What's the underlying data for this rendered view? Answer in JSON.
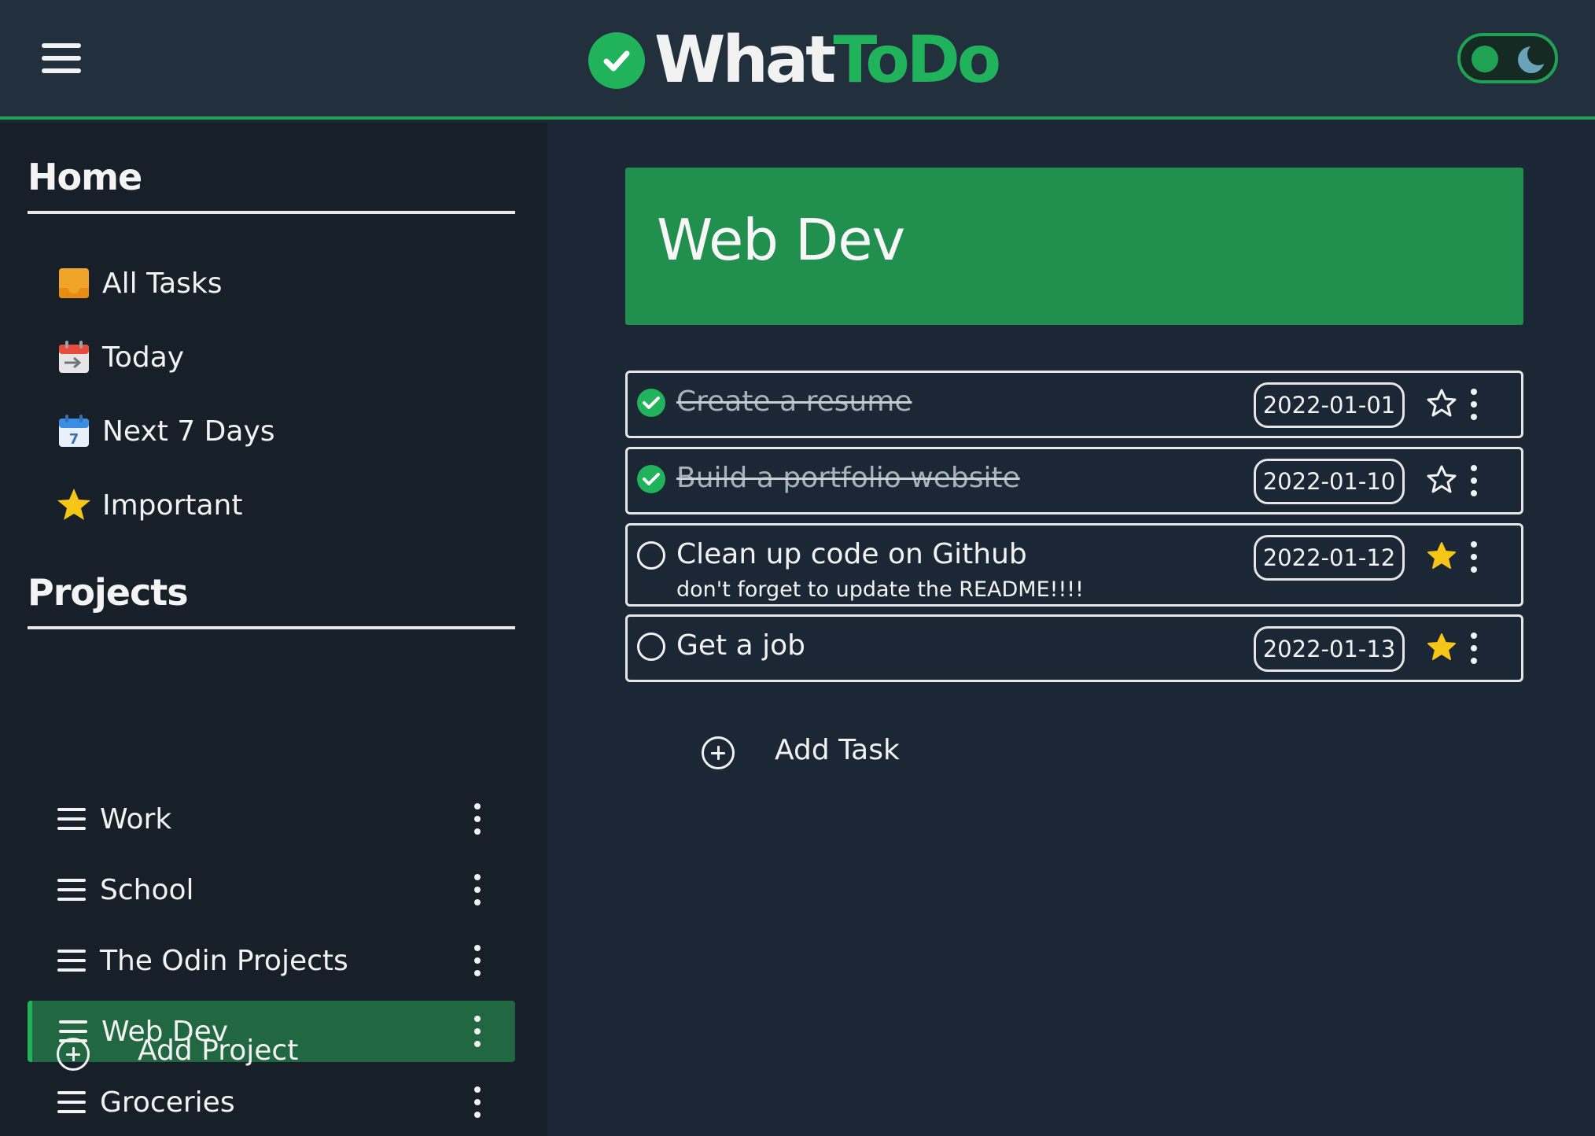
{
  "header": {
    "logo_what": "What",
    "logo_todo": "ToDo",
    "accent": "#21b35c"
  },
  "sidebar": {
    "home_title": "Home",
    "home_items": [
      {
        "label": "All Tasks",
        "icon": "inbox-tray-icon"
      },
      {
        "label": "Today",
        "icon": "calendar-today-icon"
      },
      {
        "label": "Next 7 Days",
        "icon": "calendar-week-icon"
      },
      {
        "label": "Important",
        "icon": "star-icon"
      }
    ],
    "projects_title": "Projects",
    "projects": [
      {
        "label": "Work",
        "active": false
      },
      {
        "label": "School",
        "active": false
      },
      {
        "label": "The Odin Projects",
        "active": false
      },
      {
        "label": "Web Dev",
        "active": true
      },
      {
        "label": "Groceries",
        "active": false
      }
    ],
    "add_project_label": "Add Project"
  },
  "main": {
    "project_title": "Web Dev",
    "tasks": [
      {
        "title": "Create a resume",
        "note": "",
        "date": "2022-01-01",
        "done": true,
        "important": false
      },
      {
        "title": "Build a portfolio website",
        "note": "",
        "date": "2022-01-10",
        "done": true,
        "important": false
      },
      {
        "title": "Clean up code on Github",
        "note": "don't forget to update the README!!!!",
        "date": "2022-01-12",
        "done": false,
        "important": true
      },
      {
        "title": "Get a job",
        "note": "",
        "date": "2022-01-13",
        "done": false,
        "important": true
      }
    ],
    "add_task_label": "Add Task"
  },
  "colors": {
    "background": "#1b2734",
    "sidebar": "#172029",
    "banner": "#21904f",
    "star": "#f5c518"
  }
}
